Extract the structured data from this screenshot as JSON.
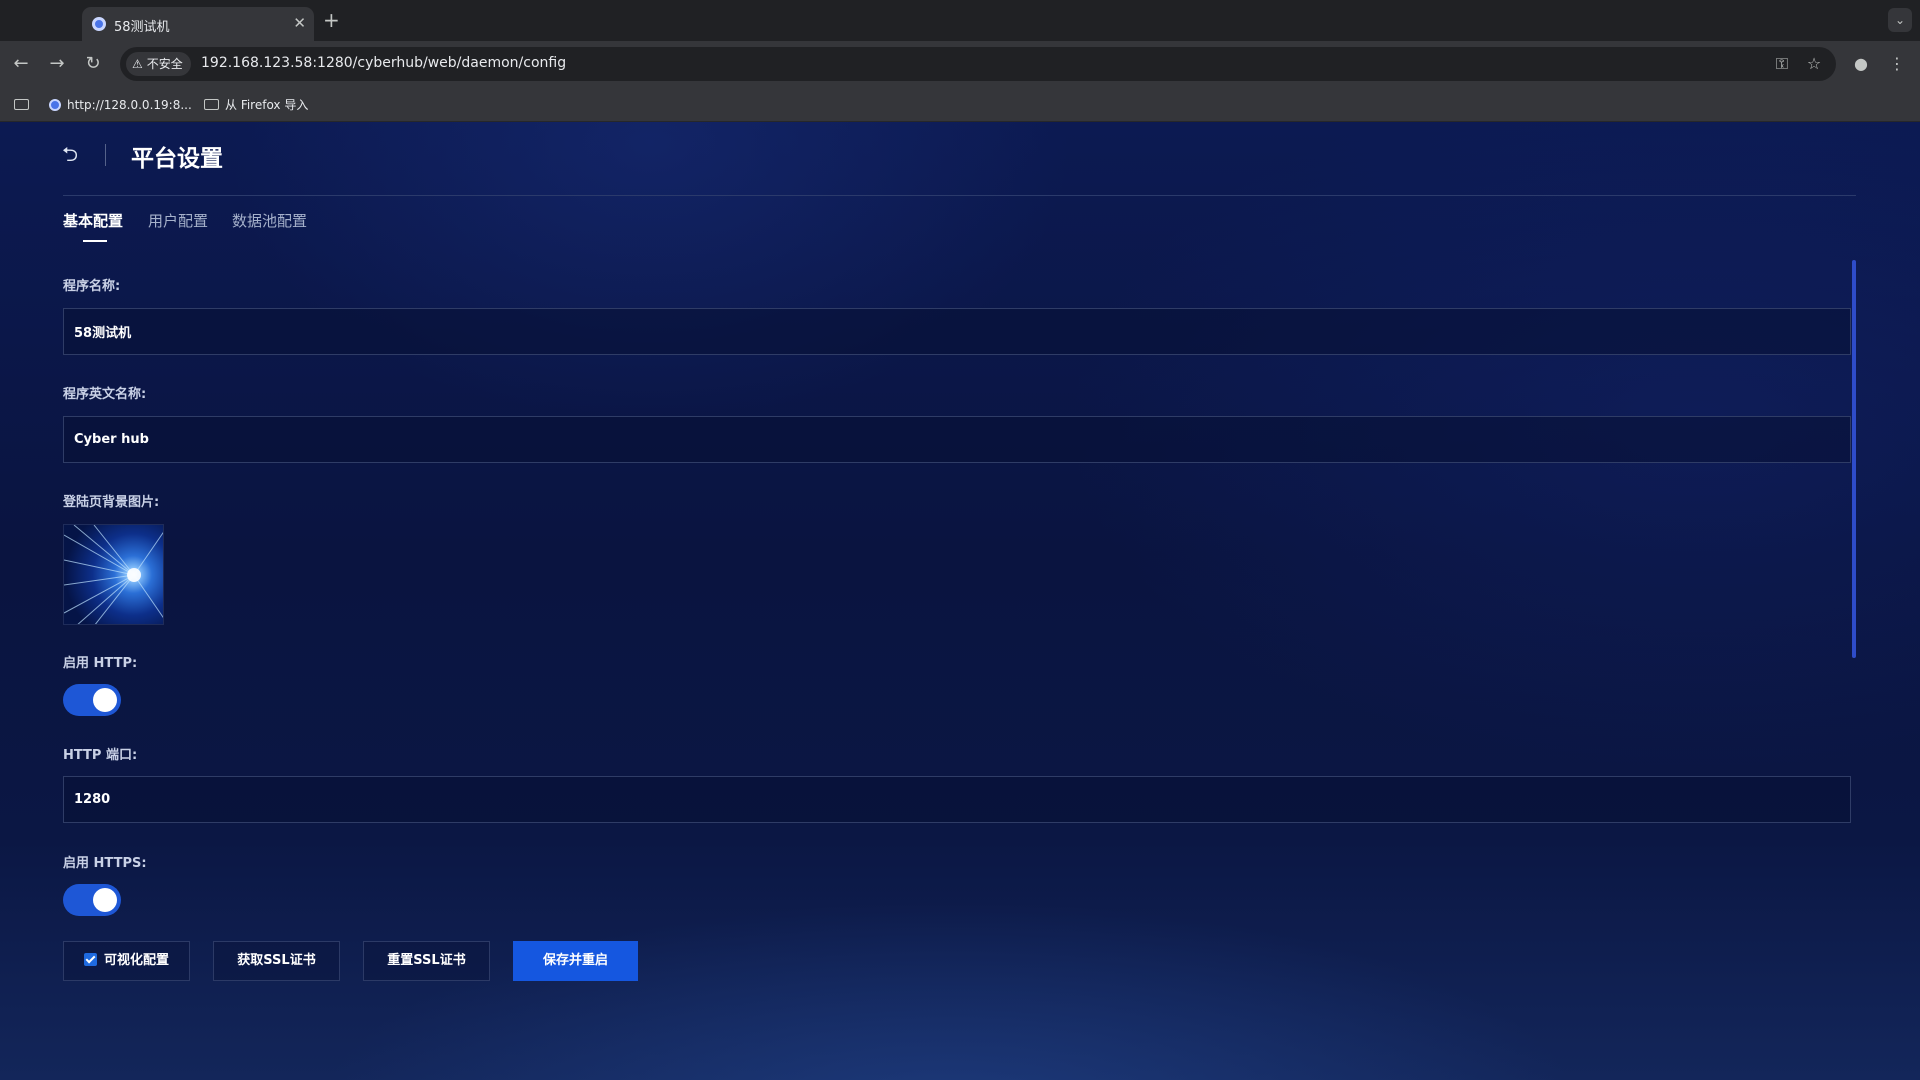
{
  "browser": {
    "tab_title": "58测试机",
    "security_label": "不安全",
    "url": "192.168.123.58:1280/cyberhub/web/daemon/config",
    "bookmarks": [
      {
        "label": "http://128.0.0.19:8...",
        "icon": "globe-icon"
      },
      {
        "label": "从 Firefox 导入",
        "icon": "folder-icon"
      }
    ]
  },
  "header": {
    "title": "平台设置"
  },
  "tabs": [
    {
      "label": "基本配置",
      "active": true
    },
    {
      "label": "用户配置",
      "active": false
    },
    {
      "label": "数据池配置",
      "active": false
    }
  ],
  "form": {
    "program_name": {
      "label": "程序名称:",
      "value": "58测试机"
    },
    "program_en_name": {
      "label": "程序英文名称:",
      "value": "Cyber hub"
    },
    "login_bg": {
      "label": "登陆页背景图片:"
    },
    "http_enabled": {
      "label": "启用 HTTP:",
      "value": true
    },
    "http_port": {
      "label": "HTTP 端口:",
      "value": "1280"
    },
    "https_enabled": {
      "label": "启用 HTTPS:",
      "value": true
    }
  },
  "actions": {
    "visual_config": {
      "label": "可视化配置",
      "checked": true
    },
    "get_ssl": "获取SSL证书",
    "reset_ssl": "重置SSL证书",
    "save_restart": "保存并重启"
  },
  "colors": {
    "accent": "#1557e0",
    "toggle_on": "#1e57d6",
    "page_bg": "#0b1640"
  }
}
